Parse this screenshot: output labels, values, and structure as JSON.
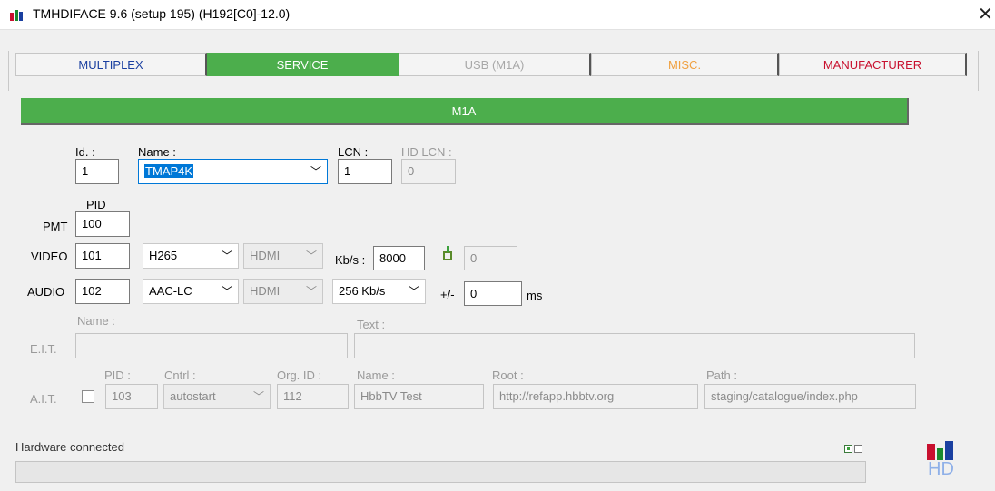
{
  "window": {
    "title": "TMHDIFACE 9.6 (setup 195) (H192[C0]-12.0)",
    "close": "✕"
  },
  "tabs": [
    {
      "label": "MULTIPLEX",
      "color": "#1a3fa0",
      "active": false
    },
    {
      "label": "SERVICE",
      "color": "#ffffff",
      "active": true
    },
    {
      "label": "USB (M1A)",
      "color": "#a8a8a8",
      "active": false
    },
    {
      "label": "MISC.",
      "color": "#f0a040",
      "active": false
    },
    {
      "label": "MANUFACTURER",
      "color": "#c8102e",
      "active": false
    }
  ],
  "section_bar": "M1A",
  "service": {
    "id_label": "Id. :",
    "id_value": "1",
    "name_label": "Name :",
    "name_value": "TMAP4K",
    "lcn_label": "LCN :",
    "lcn_value": "1",
    "hdlcn_label": "HD LCN :",
    "hdlcn_value": "0"
  },
  "pid": {
    "header": "PID",
    "pmt_label": "PMT",
    "pmt_value": "100",
    "video_label": "VIDEO",
    "video_value": "101",
    "video_codec": "H265",
    "video_source": "HDMI",
    "kbs_label": "Kb/s :",
    "kbs_value": "8000",
    "video_extra_value": "0",
    "audio_label": "AUDIO",
    "audio_value": "102",
    "audio_codec": "AAC-LC",
    "audio_source": "HDMI",
    "audio_rate": "256 Kb/s",
    "offset_label": "+/-",
    "offset_value": "0",
    "offset_unit": "ms"
  },
  "eit": {
    "label": "E.I.T.",
    "name_label": "Name :",
    "text_label": "Text :",
    "name_value": "",
    "text_value": ""
  },
  "ait": {
    "label": "A.I.T.",
    "pid_label": "PID :",
    "pid_value": "103",
    "cntrl_label": "Cntrl :",
    "cntrl_value": "autostart",
    "orgid_label": "Org. ID :",
    "orgid_value": "112",
    "name_label": "Name :",
    "name_value": "HbbTV Test",
    "root_label": "Root :",
    "root_value": "http://refapp.hbbtv.org",
    "path_label": "Path :",
    "path_value": "staging/catalogue/index.php"
  },
  "status": {
    "text": "Hardware connected"
  },
  "logo": {
    "text": "HD",
    "colors": [
      "#c8102e",
      "#1a8a2e",
      "#1a3fa0"
    ]
  },
  "accent": "#4cae4c"
}
